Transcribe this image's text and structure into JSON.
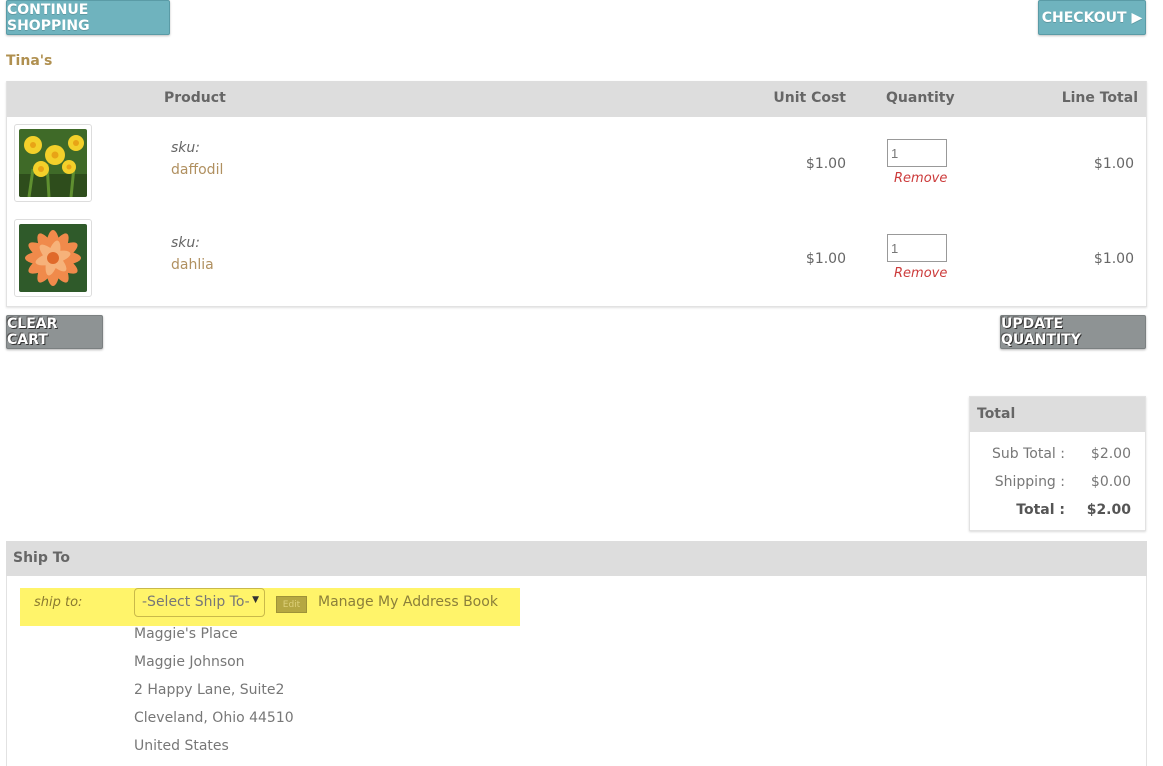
{
  "top_actions": {
    "continue_label": "CONTINUE SHOPPING",
    "checkout_label": "CHECKOUT ▶"
  },
  "store": {
    "name": "Tina's"
  },
  "cart": {
    "headers": {
      "product": "Product",
      "unit_cost": "Unit Cost",
      "quantity": "Quantity",
      "line_total": "Line Total"
    },
    "items": [
      {
        "sku_label": "sku:",
        "name": "daffodil",
        "unit_cost": "$1.00",
        "quantity": "1",
        "remove_label": "Remove",
        "line_total": "$1.00",
        "image": "daffodil-flower"
      },
      {
        "sku_label": "sku:",
        "name": "dahlia",
        "unit_cost": "$1.00",
        "quantity": "1",
        "remove_label": "Remove",
        "line_total": "$1.00",
        "image": "dahlia-flower"
      }
    ],
    "clear_label": "CLEAR CART",
    "update_label": "UPDATE QUANTITY"
  },
  "totals": {
    "title": "Total",
    "subtotal_label": "Sub Total :",
    "subtotal": "$2.00",
    "shipping_label": "Shipping :",
    "shipping": "$0.00",
    "total_label": "Total :",
    "total": "$2.00"
  },
  "ship": {
    "title": "Ship To",
    "label": "ship to:",
    "select_value": "-Select Ship To-",
    "edit_label": "Edit",
    "address_book_link": "Manage My Address Book",
    "address_lines": [
      "Maggie's Place",
      "Maggie Johnson",
      "2 Happy Lane, Suite2",
      "Cleveland, Ohio 44510",
      "United States"
    ]
  },
  "colors": {
    "teal_button": "#6fb3be",
    "gray_button": "#8e9394",
    "header_bg": "#dddddd",
    "highlight": "#fff46a",
    "remove_red": "#cc3b3b",
    "product_link": "#b09060"
  }
}
